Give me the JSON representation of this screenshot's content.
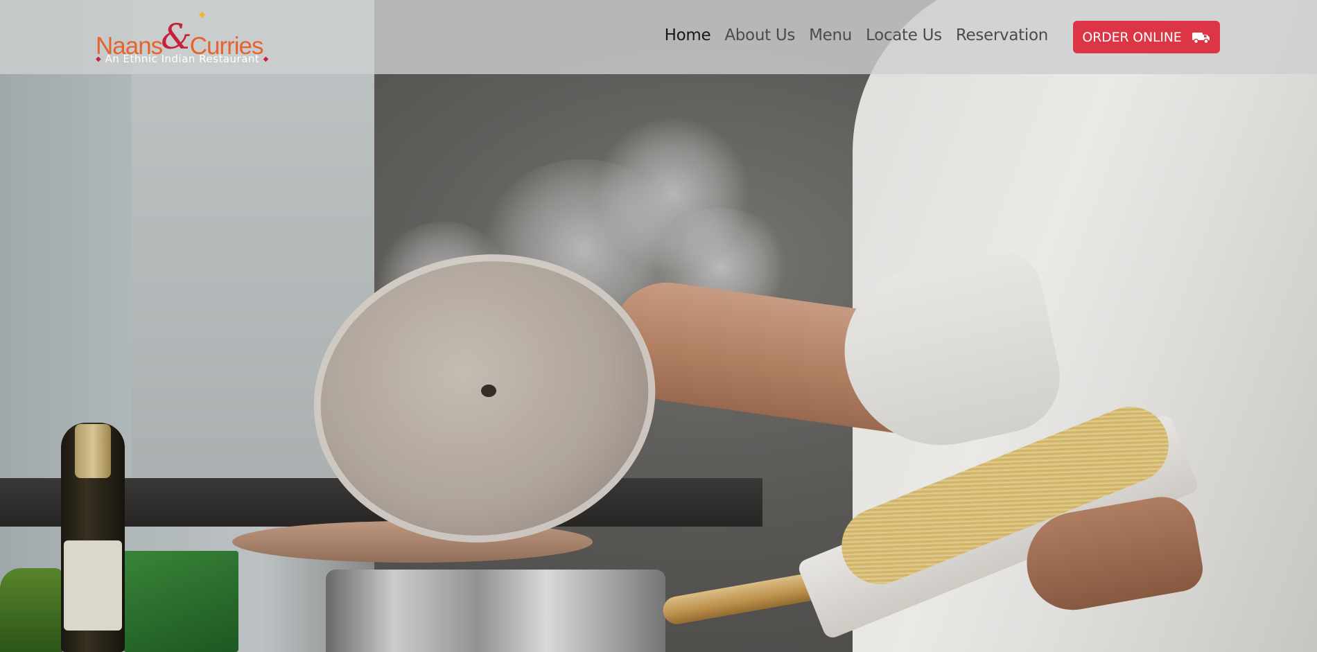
{
  "brand": {
    "name_part1": "Naans",
    "name_amp": "&",
    "name_part2": "Curries",
    "tagline": "An Ethnic Indian Restaurant",
    "accent_color": "#e7632e",
    "amp_color": "#c6203b"
  },
  "nav": {
    "items": [
      {
        "label": "Home",
        "active": true
      },
      {
        "label": "About Us",
        "active": false
      },
      {
        "label": "Menu",
        "active": false
      },
      {
        "label": "Locate Us",
        "active": false
      },
      {
        "label": "Reservation",
        "active": false
      }
    ]
  },
  "order_button": {
    "label": "ORDER ONLINE",
    "icon": "truck-icon",
    "color": "#dc3545"
  },
  "hero": {
    "media": "chef-lifting-pot-lid-steam-video"
  }
}
